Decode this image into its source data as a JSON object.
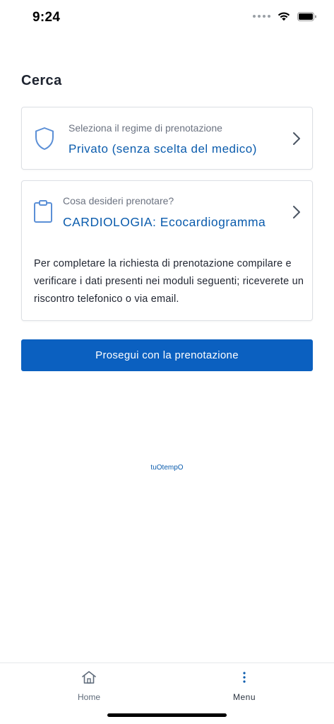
{
  "status_bar": {
    "time": "9:24"
  },
  "page": {
    "title": "Cerca"
  },
  "booking_regime": {
    "label": "Seleziona il regime di prenotazione",
    "value": "Privato (senza scelta del medico)",
    "icon": "shield-icon"
  },
  "booking_service": {
    "label": "Cosa desideri prenotare?",
    "value": "CARDIOLOGIA: Ecocardiogramma",
    "icon": "clipboard-icon",
    "note": "Per completare la richiesta di prenotazione compilare e verificare i dati presenti nei moduli seguenti; riceverete un riscontro telefonico o via email."
  },
  "actions": {
    "continue_label": "Prosegui con la prenotazione"
  },
  "footer": {
    "brand": "tuOtempO"
  },
  "tab_bar": {
    "home_label": "Home",
    "menu_label": "Menu"
  },
  "colors": {
    "accent": "#0b5cad",
    "button": "#0b60c0",
    "icon": "#5b8fd6"
  }
}
